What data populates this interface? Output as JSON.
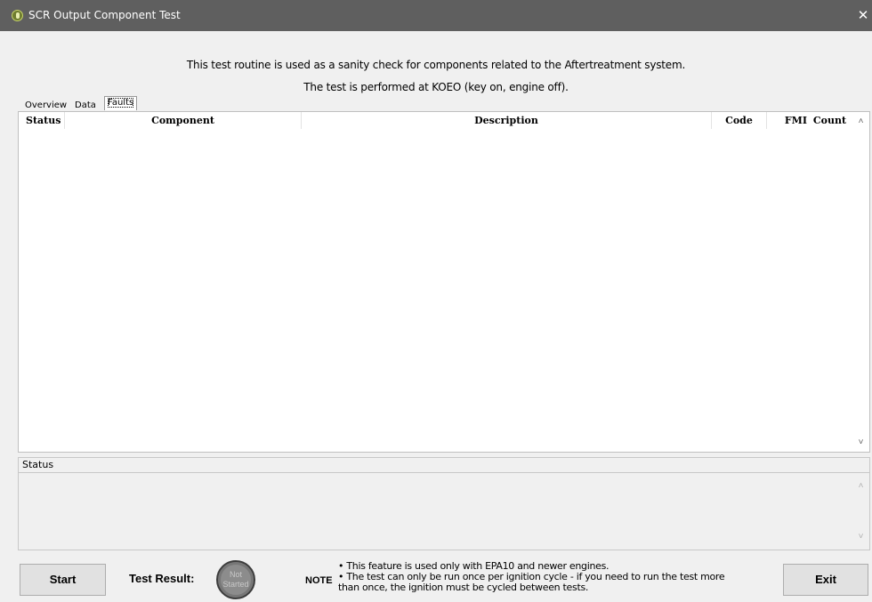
{
  "window": {
    "title": "SCR Output Component Test",
    "close_glyph": "✕"
  },
  "intro": {
    "line1": "This test routine is used as a sanity check for components related to the Aftertreatment system.",
    "line2": "The test is performed at KOEO (key on, engine off)."
  },
  "tabs": {
    "overview": "Overview",
    "data": "Data",
    "faults": "Faults",
    "active": "Faults"
  },
  "faults_table": {
    "columns": {
      "status": "Status",
      "component": "Component",
      "description": "Description",
      "code": "Code",
      "fmi": "FMI",
      "count": "Count"
    },
    "rows": []
  },
  "status_panel": {
    "header": "Status",
    "text": ""
  },
  "buttons": {
    "start": "Start",
    "exit": "Exit"
  },
  "test_result": {
    "label": "Test Result:",
    "state_line1": "Not",
    "state_line2": "Started"
  },
  "note": {
    "label": "NOTE",
    "line1": "• This feature is used only with EPA10 and newer engines.",
    "line2": "• The test can only be run once per ignition cycle - if you need to run the test more",
    "line3": "than once, the ignition must be cycled between tests."
  },
  "icons": {
    "app": "app-logo-icon",
    "close": "close-icon",
    "scroll_up": "chevron-up-icon",
    "scroll_down": "chevron-down-icon"
  }
}
